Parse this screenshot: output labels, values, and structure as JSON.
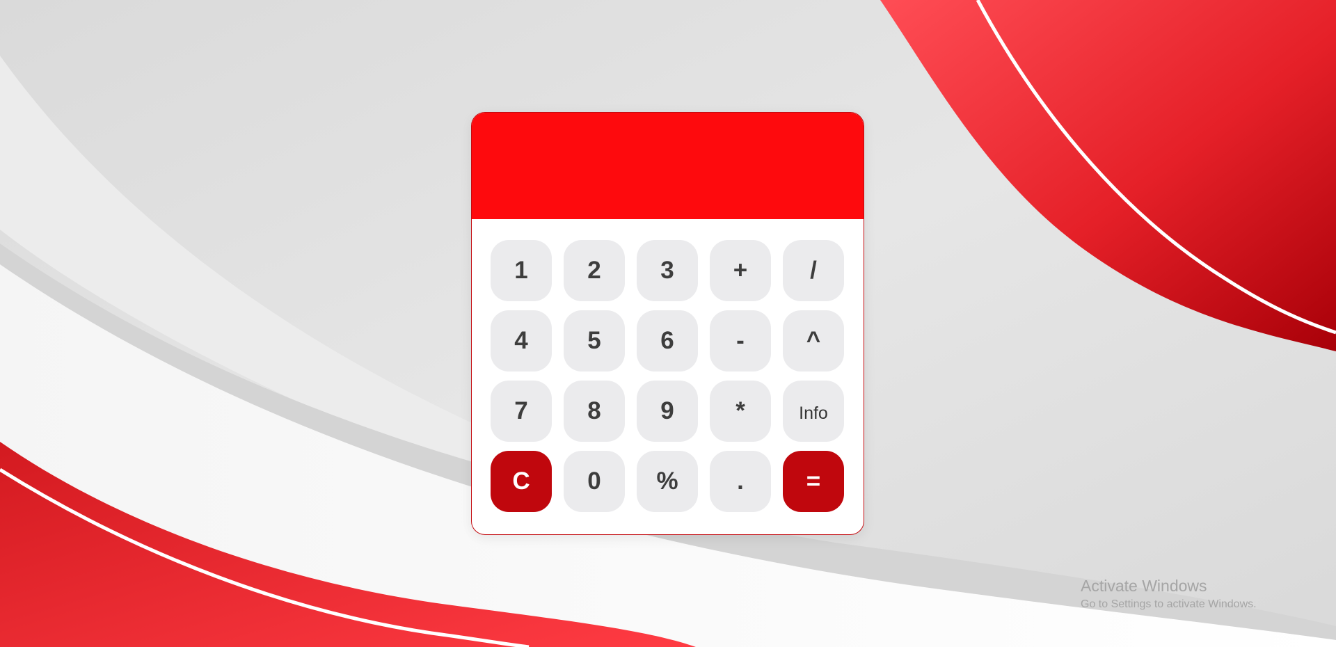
{
  "display": {
    "value": ""
  },
  "keypad": {
    "rows": [
      [
        {
          "label": "1",
          "name": "key-1"
        },
        {
          "label": "2",
          "name": "key-2"
        },
        {
          "label": "3",
          "name": "key-3"
        },
        {
          "label": "+",
          "name": "add-button"
        },
        {
          "label": "/",
          "name": "divide-button"
        }
      ],
      [
        {
          "label": "4",
          "name": "key-4"
        },
        {
          "label": "5",
          "name": "key-5"
        },
        {
          "label": "6",
          "name": "key-6"
        },
        {
          "label": "-",
          "name": "subtract-button"
        },
        {
          "label": "^",
          "name": "power-button"
        }
      ],
      [
        {
          "label": "7",
          "name": "key-7"
        },
        {
          "label": "8",
          "name": "key-8"
        },
        {
          "label": "9",
          "name": "key-9"
        },
        {
          "label": "*",
          "name": "multiply-button"
        },
        {
          "label": "Info",
          "name": "info-button"
        }
      ],
      [
        {
          "label": "C",
          "name": "clear-button"
        },
        {
          "label": "0",
          "name": "key-0"
        },
        {
          "label": "%",
          "name": "percent-button"
        },
        {
          "label": ".",
          "name": "decimal-button"
        },
        {
          "label": "=",
          "name": "equals-button"
        }
      ]
    ]
  },
  "watermark": {
    "title": "Activate Windows",
    "subtitle": "Go to Settings to activate Windows."
  },
  "colors": {
    "display_bg": "#fe0a0d",
    "accent_key": "#c0070d",
    "key_bg": "#ebebed",
    "key_text": "#3d3d3d"
  }
}
